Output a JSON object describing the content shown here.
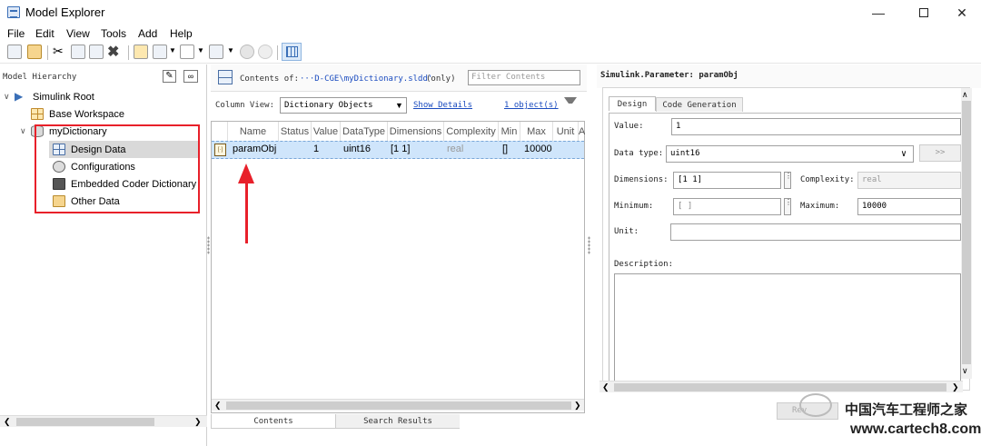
{
  "window": {
    "title": "Model Explorer"
  },
  "menu": [
    "File",
    "Edit",
    "View",
    "Tools",
    "Add",
    "Help"
  ],
  "hierarchy": {
    "header": "Model Hierarchy",
    "root": "Simulink Root",
    "base": "Base Workspace",
    "dictionary": "myDictionary",
    "children": [
      "Design Data",
      "Configurations",
      "Embedded Coder Dictionary",
      "Other Data"
    ]
  },
  "contents": {
    "label": "Contents of:",
    "path": "···D-CGE\\myDictionary.sldd'",
    "only": "(only)",
    "filter_placeholder": "Filter Contents",
    "column_view_label": "Column View:",
    "column_view_value": "Dictionary Objects",
    "show_details": "Show Details",
    "object_count": "1 object(s)",
    "columns": [
      "Name",
      "Status",
      "Value",
      "DataType",
      "Dimensions",
      "Complexity",
      "Min",
      "Max",
      "Unit",
      "A"
    ],
    "row": {
      "name": "paramObj",
      "status": "",
      "value": "1",
      "datatype": "uint16",
      "dimensions": "[1 1]",
      "complexity": "real",
      "min": "[]",
      "max": "10000",
      "unit": ""
    },
    "tabs": [
      "Contents",
      "Search Results"
    ]
  },
  "properties": {
    "title": "Simulink.Parameter: paramObj",
    "tabs": [
      "Design",
      "Code Generation"
    ],
    "value_label": "Value:",
    "value": "1",
    "datatype_label": "Data type:",
    "datatype": "uint16",
    "datatype_btn": ">>",
    "dimensions_label": "Dimensions:",
    "dimensions": "[1 1]",
    "complexity_label": "Complexity:",
    "complexity": "real",
    "minimum_label": "Minimum:",
    "minimum": "[ ]",
    "maximum_label": "Maximum:",
    "maximum": "10000",
    "unit_label": "Unit:",
    "unit": "",
    "description_label": "Description:",
    "revert_label": "Rev",
    "watermark": "www.cartech8.com",
    "watermark_cn": "中国汽车工程师之家"
  }
}
